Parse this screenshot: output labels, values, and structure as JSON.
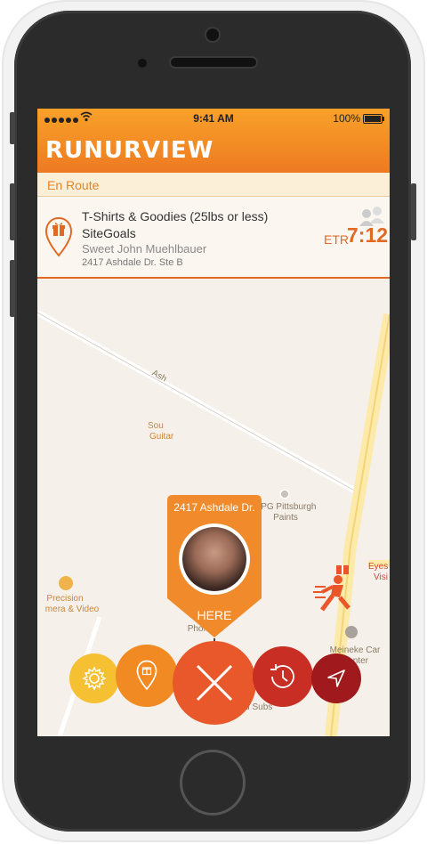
{
  "status_bar": {
    "time": "9:41 AM",
    "battery": "100%"
  },
  "app": {
    "logo": "RUNURVIEW"
  },
  "delivery": {
    "status": "En Route",
    "item": "T-Shirts & Goodies (25lbs or less)",
    "company": "SiteGoals",
    "recipient": "Sweet John Muehlbauer",
    "address": "2417 Ashdale Dr. Ste B",
    "etr_label": "ETR",
    "etr_value": "7:12"
  },
  "map": {
    "pin_address": "2417 Ashdale Dr.",
    "pin_label": "HERE",
    "labels": {
      "street": "Ash",
      "sound_1": "Sou",
      "sound_2": "Guitar",
      "ppg_1": "PPG Pittsburgh",
      "ppg_2": "Paints",
      "precision_1": "Precision",
      "precision_2": "mera & Video",
      "phonatic": "PhoNatic",
      "eyes_1": "Eyes",
      "eyes_2": "Visi",
      "meineke_1": "Meineke Car",
      "meineke_2": "Center",
      "subs": "oud Subs"
    }
  },
  "actions": [
    {
      "name": "settings-button",
      "icon": "gear-icon",
      "color": "#f6c033"
    },
    {
      "name": "delivery-pin-button",
      "icon": "gift-pin-icon",
      "color": "#f28a24"
    },
    {
      "name": "cancel-button",
      "icon": "close-icon",
      "color": "#e8582a"
    },
    {
      "name": "history-button",
      "icon": "history-icon",
      "color": "#c92e25"
    },
    {
      "name": "navigate-button",
      "icon": "location-arrow-icon",
      "color": "#a0191d"
    }
  ],
  "colors": {
    "accent": "#f28a24",
    "header_top": "#f9a12a",
    "status_red": "#e06a24"
  }
}
